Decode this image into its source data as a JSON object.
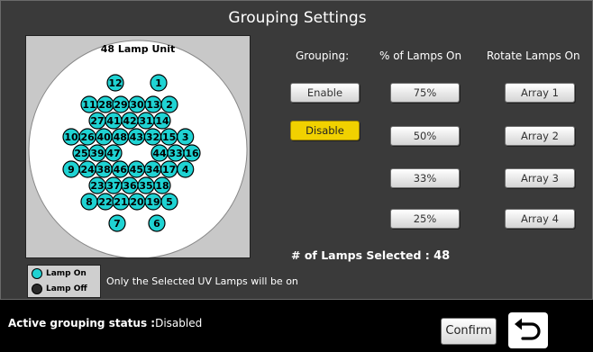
{
  "title": "Grouping Settings",
  "lamp_unit": {
    "title": "48 Lamp Unit",
    "lamp_color": "#1fd3d3",
    "rows": [
      [
        "12",
        "1"
      ],
      [
        "11",
        "28",
        "29",
        "30",
        "13",
        "2"
      ],
      [
        "27",
        "41",
        "42",
        "31",
        "14"
      ],
      [
        "10",
        "26",
        "40",
        "48",
        "43",
        "32",
        "15",
        "3"
      ],
      [
        "25",
        "39",
        "47",
        "44",
        "33",
        "16"
      ],
      [
        "9",
        "24",
        "38",
        "46",
        "45",
        "34",
        "17",
        "4"
      ],
      [
        "23",
        "37",
        "36",
        "35",
        "18"
      ],
      [
        "8",
        "22",
        "21",
        "20",
        "19",
        "5"
      ],
      [
        "7",
        "6"
      ]
    ]
  },
  "columns": {
    "grouping": "Grouping:",
    "percent": "% of Lamps On",
    "rotate": "Rotate Lamps On"
  },
  "grouping": {
    "enable": "Enable",
    "disable": "Disable",
    "selected": "Disable"
  },
  "percent_buttons": [
    "75%",
    "50%",
    "33%",
    "25%"
  ],
  "rotate_buttons": [
    "Array 1",
    "Array 2",
    "Array 3",
    "Array 4"
  ],
  "selected_count": {
    "label": "# of Lamps Selected :",
    "value": "48"
  },
  "legend": {
    "on_label": "Lamp On",
    "off_label": "Lamp Off",
    "on_color": "#1fd3d3",
    "off_color": "#2a2a2a"
  },
  "note": "Only the Selected UV Lamps will be on",
  "status": {
    "label": "Active grouping status :",
    "value": "Disabled"
  },
  "confirm_label": "Confirm",
  "back_icon": "undo-arrow-icon",
  "colors": {
    "selected_button": "#f1d100",
    "panel_bg": "#3a3a3a"
  }
}
